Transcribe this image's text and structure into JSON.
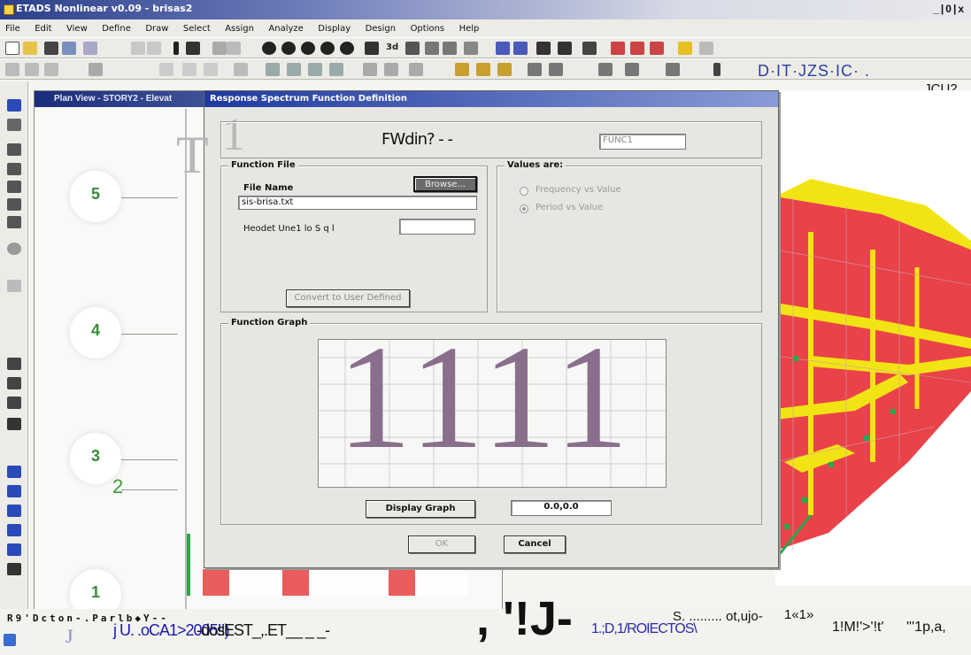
{
  "window": {
    "title": "ETADS Nonlinear v0.09 - brisas2",
    "controls": "_|0|x"
  },
  "menu": [
    "File",
    "Edit",
    "View",
    "Define",
    "Draw",
    "Select",
    "Assign",
    "Analyze",
    "Display",
    "Design",
    "Options",
    "Help"
  ],
  "toolbar": {
    "view_3d": "3d",
    "units_text": "D·IT·JZS·IC· .",
    "units_text_2": ".JCU2"
  },
  "plan_view": {
    "title": "Plan View - STORY2 - Elevat",
    "grid_bubbles": [
      "5",
      "4",
      "3",
      "1"
    ],
    "extra_label": "2"
  },
  "dialog": {
    "title": "Response Spectrum Function Definition",
    "function_name_label": "FWdin? - -",
    "function_name_value": "FUNC1",
    "function_file": {
      "group_label": "Function File",
      "file_name_label": "File Name",
      "browse_label": "Browse...",
      "file_name_value": "sis-brisa.txt",
      "header_lines_label": "Heodet Une1 lo S q l",
      "header_lines_value": "",
      "convert_label": "Convert to User Defined"
    },
    "values_are": {
      "group_label": "Values are:",
      "option_1": "Frequency vs Value",
      "option_2": "Period vs Value"
    },
    "graph": {
      "group_label": "Function Graph",
      "overlay_text": "1111",
      "display_graph_label": "Display Graph",
      "readout_value": "0.0,0.0"
    },
    "ok_label": "OK",
    "cancel_label": "Cancel",
    "deco_T": "T",
    "deco_1": "1"
  },
  "status_bar": {
    "left_text": "R9'Dcton-.Parlb◆Y--",
    "task_glyph": "J",
    "task_1a": "j U. .oCA1>2005!!)",
    "task_1b": "-dosEST_,.ET__ _ _-",
    "big_glyph": ", '!J-",
    "task_2": "1.;D,1/ROIECTOS\\",
    "task_3": "S. ......... ot,ujo-",
    "task_4": "1«1»",
    "task_5": "1!M!'>'!t'",
    "task_6": "'''1p,a,"
  },
  "colors": {
    "title_gradient_start": "#2b3f8a",
    "building_fill": "#e8323a",
    "beam_yellow": "#f2e414",
    "support_green": "#2aa84a",
    "grid_green": "#3a8a3a"
  }
}
